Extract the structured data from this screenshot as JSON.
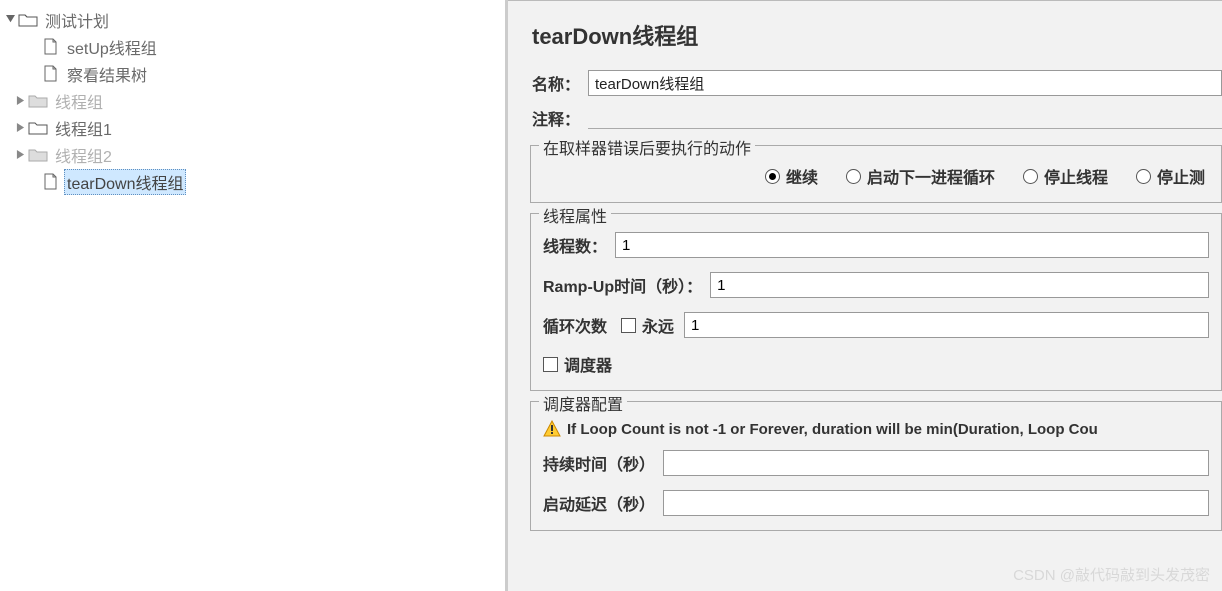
{
  "tree": {
    "root": {
      "label": "测试计划"
    },
    "items": [
      {
        "label": "setUp线程组"
      },
      {
        "label": "察看结果树"
      },
      {
        "label": "线程组",
        "disabled": true
      },
      {
        "label": "线程组1"
      },
      {
        "label": "线程组2",
        "disabled": true
      },
      {
        "label": "tearDown线程组",
        "selected": true
      }
    ]
  },
  "panel": {
    "title": "tearDown线程组",
    "nameLabel": "名称：",
    "nameValue": "tearDown线程组",
    "commentLabel": "注释："
  },
  "errorAction": {
    "legend": "在取样器错误后要执行的动作",
    "options": [
      {
        "label": "继续",
        "checked": true
      },
      {
        "label": "启动下一进程循环",
        "checked": false
      },
      {
        "label": "停止线程",
        "checked": false
      },
      {
        "label": "停止测",
        "checked": false
      }
    ]
  },
  "threadProps": {
    "legend": "线程属性",
    "threadsLabel": "线程数：",
    "threadsValue": "1",
    "rampLabel": "Ramp-Up时间（秒）：",
    "rampValue": "1",
    "loopLabel": "循环次数",
    "foreverLabel": "永远",
    "loopValue": "1",
    "schedulerLabel": "调度器"
  },
  "scheduler": {
    "legend": "调度器配置",
    "warning": "If Loop Count is not -1 or Forever, duration will be min(Duration, Loop Cou",
    "durationLabel": "持续时间（秒）",
    "durationValue": "",
    "delayLabel": "启动延迟（秒）",
    "delayValue": ""
  },
  "watermark": "CSDN @敲代码敲到头发茂密"
}
